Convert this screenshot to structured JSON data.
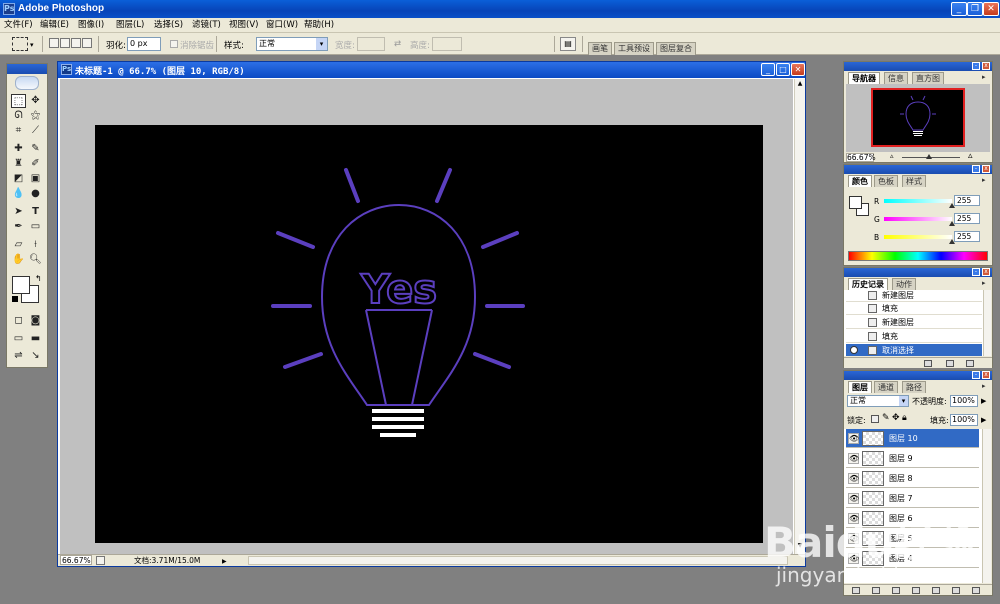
{
  "app": {
    "title": "Adobe Photoshop",
    "icon_letters": "Ps",
    "window_controls": [
      "minimize-icon",
      "restore-icon",
      "close-icon"
    ]
  },
  "menu": [
    "文件(F)",
    "编辑(E)",
    "图像(I)",
    "图层(L)",
    "选择(S)",
    "滤镜(T)",
    "视图(V)",
    "窗口(W)",
    "帮助(H)"
  ],
  "options_bar": {
    "feather_label": "羽化:",
    "feather_value": "0 px",
    "antialias_label": "消除锯齿",
    "style_label": "样式:",
    "style_value": "正常",
    "width_label": "宽度:",
    "height_label": "高度:",
    "well_tabs": [
      "画笔",
      "工具预设",
      "图层复合"
    ]
  },
  "document": {
    "title": "未标题-1 @ 66.7% (图层 10, RGB/8)",
    "zoom": "66.67%",
    "doc_info": "文档:3.71M/15.0M",
    "artwork": {
      "text": "Yes",
      "stroke_color": "#5b3fbf",
      "base_color": "#ffffff",
      "background": "#000000"
    }
  },
  "navigator": {
    "tabs": [
      "导航器",
      "信息",
      "直方图"
    ],
    "zoom": "66.67%",
    "view_box_color": "#e02020"
  },
  "color": {
    "tabs": [
      "颜色",
      "色板",
      "样式"
    ],
    "channels": [
      {
        "label": "R",
        "value": "255"
      },
      {
        "label": "G",
        "value": "255"
      },
      {
        "label": "B",
        "value": "255"
      }
    ]
  },
  "history": {
    "tabs": [
      "历史记录",
      "动作"
    ],
    "items": [
      {
        "label": "新建图层",
        "selected": false
      },
      {
        "label": "填充",
        "selected": false
      },
      {
        "label": "新建图层",
        "selected": false
      },
      {
        "label": "填充",
        "selected": false
      },
      {
        "label": "取消选择",
        "selected": true
      }
    ]
  },
  "layers": {
    "tabs": [
      "图层",
      "通道",
      "路径"
    ],
    "blend_mode": "正常",
    "opacity_label": "不透明度:",
    "opacity_value": "100%",
    "lock_label": "锁定:",
    "fill_label": "填充:",
    "fill_value": "100%",
    "items": [
      {
        "name": "图层 10",
        "selected": true
      },
      {
        "name": "图层 9",
        "selected": false
      },
      {
        "name": "图层 8",
        "selected": false
      },
      {
        "name": "图层 7",
        "selected": false
      },
      {
        "name": "图层 6",
        "selected": false
      },
      {
        "name": "图层 5",
        "selected": false
      },
      {
        "name": "图层 4",
        "selected": false
      }
    ]
  },
  "watermark": {
    "line1": "Baidu经验",
    "line2": "jingyan.baidu.com"
  }
}
